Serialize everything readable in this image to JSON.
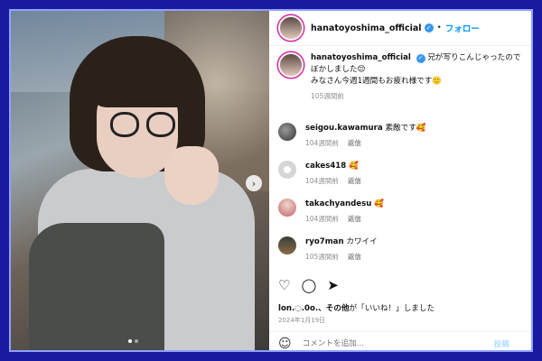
{
  "header": {
    "username": "hanatoyoshima_official",
    "separator": "•",
    "follow_label": "フォロー"
  },
  "caption": {
    "username": "hanatoyoshima_official",
    "text_line1": "兄が写りこんじゃったのでぼかしました😌",
    "text_line2": "みなさん今週1週間もお疲れ様です🙂",
    "time": "105週間前"
  },
  "comments": [
    {
      "username": "seigou.kawamura",
      "text": "素敵です🥰",
      "time": "104週間前",
      "reply": "返信"
    },
    {
      "username": "cakes418",
      "text": "🥰",
      "time": "104週間前",
      "reply": "返信"
    },
    {
      "username": "takachyandesu",
      "text": "🥰",
      "time": "104週間前",
      "reply": "返信"
    },
    {
      "username": "ryo7man",
      "text": "カワイイ",
      "time": "105週間前",
      "reply": "返信"
    }
  ],
  "likes": {
    "user": "lon.◌.0o.",
    "suffix": "、その他",
    "tail": "が「いいね！」しました"
  },
  "date": "2024年1月19日",
  "composer": {
    "placeholder": "コメントを追加...",
    "post_label": "投稿"
  },
  "icons": [
    "heart-icon",
    "comment-icon",
    "share-icon",
    "emoji-icon",
    "verified-icon",
    "chevron-right-icon"
  ],
  "colors": {
    "accent": "#0095f6",
    "frame": "#1a1aa0",
    "muted": "#8e8e8e"
  }
}
